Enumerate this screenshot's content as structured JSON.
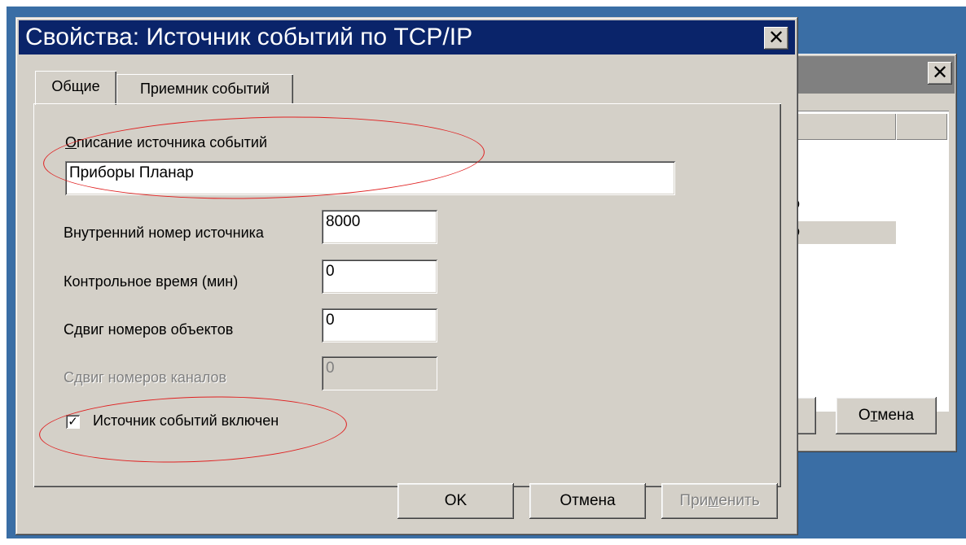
{
  "background_dialog": {
    "close_glyph": "✕",
    "list_fragment_1": "о",
    "list_fragment_2": "о",
    "cancel_pre": "О",
    "cancel_ul": "т",
    "cancel_post": "мена"
  },
  "dialog": {
    "title": "Свойства: Источник событий по TCP/IP",
    "close_glyph": "✕",
    "tabs": [
      {
        "label": "Общие",
        "active": true
      },
      {
        "label": "Приемник событий",
        "active": false
      }
    ],
    "description": {
      "label_ul": "О",
      "label_rest": "писание источника событий",
      "value": "Приборы Планар"
    },
    "fields": [
      {
        "label": "Внутренний номер источника",
        "value": "8000",
        "enabled": true
      },
      {
        "label": "Контрольное время (мин)",
        "value": "0",
        "enabled": true
      },
      {
        "label": "Сдвиг номеров объектов",
        "value": "0",
        "enabled": true
      },
      {
        "label": "Сдвиг номеров каналов",
        "value": "0",
        "enabled": false
      }
    ],
    "enabled_checkbox": {
      "label": "Источник событий включен",
      "checked": true,
      "mark": "✓"
    },
    "buttons": {
      "ok": "OK",
      "cancel": "Отмена",
      "apply_pre": "При",
      "apply_ul": "м",
      "apply_post": "енить"
    }
  },
  "colors": {
    "title_active": "#0a246a",
    "title_inactive": "#808080",
    "face": "#d4d0c8",
    "desktop": "#3a6ea5",
    "annotation": "#e02020"
  }
}
